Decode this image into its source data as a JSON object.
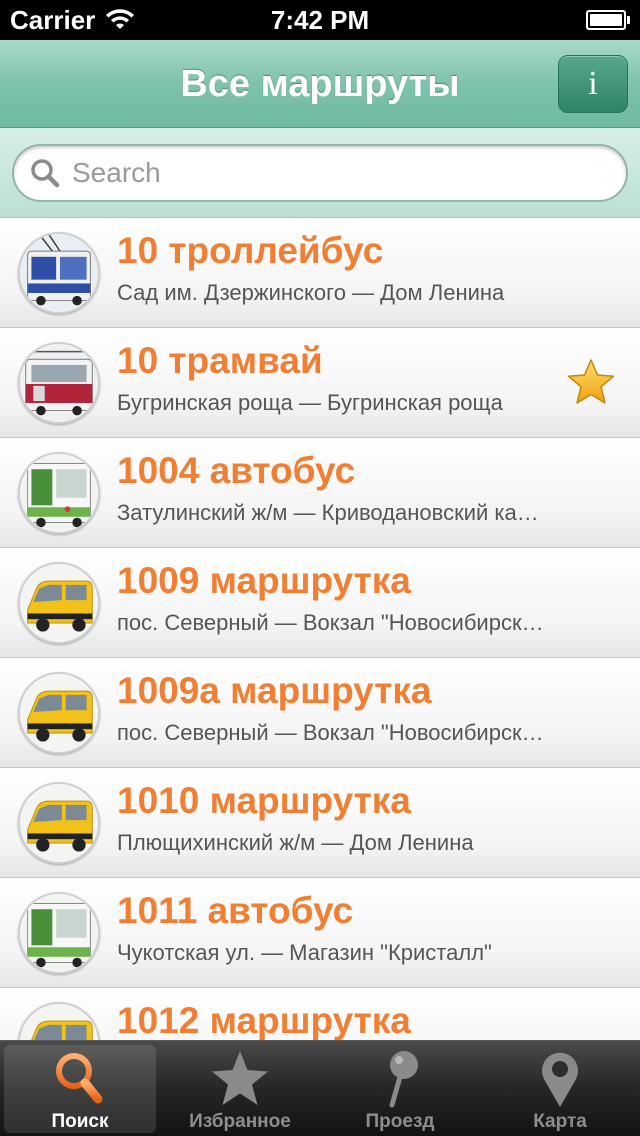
{
  "status_bar": {
    "carrier": "Carrier",
    "time": "7:42 PM"
  },
  "nav": {
    "title": "Все маршруты",
    "info_label": "i"
  },
  "search": {
    "placeholder": "Search",
    "value": ""
  },
  "routes": [
    {
      "title": "10 троллейбус",
      "subtitle": "Сад им. Дзержинского — Дом Ленина",
      "type": "trolleybus",
      "favorite": false
    },
    {
      "title": "10 трамвай",
      "subtitle": "Бугринская роща — Бугринская роща",
      "type": "tram",
      "favorite": true
    },
    {
      "title": "1004 автобус",
      "subtitle": "Затулинский ж/м — Криводановский ка…",
      "type": "bus",
      "favorite": false
    },
    {
      "title": "1009 маршрутка",
      "subtitle": "пос. Северный — Вокзал \"Новосибирск…",
      "type": "minibus",
      "favorite": false
    },
    {
      "title": "1009а маршрутка",
      "subtitle": "пос. Северный — Вокзал \"Новосибирск…",
      "type": "minibus",
      "favorite": false
    },
    {
      "title": "1010 маршрутка",
      "subtitle": "Плющихинский ж/м — Дом Ленина",
      "type": "minibus",
      "favorite": false
    },
    {
      "title": "1011 автобус",
      "subtitle": "Чукотская ул. — Магазин \"Кристалл\"",
      "type": "bus",
      "favorite": false
    },
    {
      "title": "1012 маршрутка",
      "subtitle": "",
      "type": "minibus",
      "favorite": false
    }
  ],
  "tabs": [
    {
      "label": "Поиск",
      "icon": "search-icon",
      "selected": true
    },
    {
      "label": "Избранное",
      "icon": "star-icon",
      "selected": false
    },
    {
      "label": "Проезд",
      "icon": "pin-icon",
      "selected": false
    },
    {
      "label": "Карта",
      "icon": "map-marker-icon",
      "selected": false
    }
  ],
  "colors": {
    "accent_orange": "#f07f33",
    "nav_green": "#7fc3ad",
    "star_gold": "#f6b81c"
  }
}
